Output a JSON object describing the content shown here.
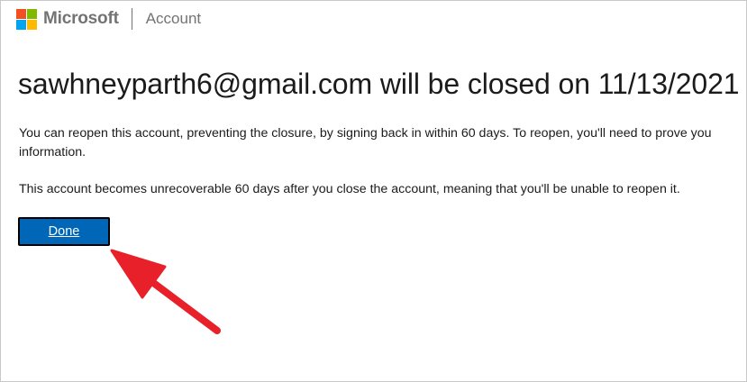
{
  "header": {
    "brand": "Microsoft",
    "section": "Account",
    "logo_colors": [
      "#f25022",
      "#7fba00",
      "#00a4ef",
      "#ffb900"
    ]
  },
  "main": {
    "title": "sawhneyparth6@gmail.com will be closed on 11/13/2021",
    "paragraph1_line1": "You can reopen this account, preventing the closure, by signing back in within 60 days. To reopen, you'll need to prove you",
    "paragraph1_line2": "information.",
    "paragraph2": "This account becomes unrecoverable 60 days after you close the account, meaning that you'll be unable to reopen it.",
    "done_label": "Done"
  },
  "colors": {
    "button": "#0067b8",
    "annotation_arrow": "#e8202a"
  }
}
